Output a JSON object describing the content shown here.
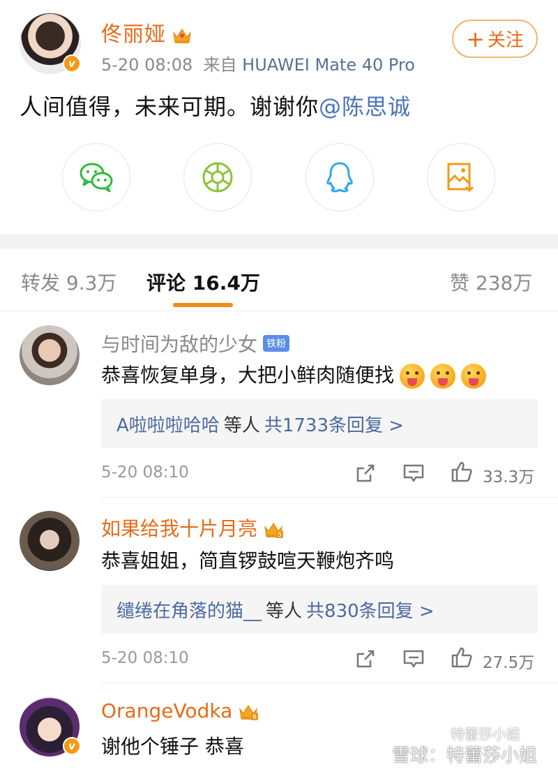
{
  "post": {
    "author": "佟丽娅",
    "time": "5-20 08:08",
    "source_prefix": "来自",
    "device": "HUAWEI Mate 40 Pro",
    "follow_label": "关注",
    "text": "人间值得，未来可期。谢谢你",
    "mention": "@陈思诚",
    "verified_badge": "v"
  },
  "share": [
    {
      "icon": "wechat-icon",
      "color": "#2dbb3c"
    },
    {
      "icon": "moments-icon",
      "color": "#8ac23a"
    },
    {
      "icon": "qq-icon",
      "color": "#2ea7e8"
    },
    {
      "icon": "save-image-icon",
      "color": "#f29a16"
    }
  ],
  "tabs": {
    "repost": "转发 9.3万",
    "comments": "评论 16.4万",
    "likes": "赞 238万"
  },
  "comments": [
    {
      "name": "与时间为敌的少女",
      "tag": "铁粉",
      "text": "恭喜恢复单身，大把小鲜肉随便找",
      "reply_who": "A啦啦啦哈哈",
      "reply_mid": "等人",
      "reply_count": "共1733条回复 >",
      "time": "5-20 08:10",
      "likes": "33.3万"
    },
    {
      "name": "如果给我十片月亮",
      "crown_level": "5",
      "text": "恭喜姐姐，简直锣鼓喧天鞭炮齐鸣",
      "reply_who": "缱绻在角落的猫__",
      "reply_mid": "等人",
      "reply_count": "共830条回复 >",
      "time": "5-20 08:10",
      "likes": "27.5万"
    },
    {
      "name": "OrangeVodka",
      "crown_level": "6",
      "text": "谢他个锤子 恭喜",
      "verified_badge": "v"
    }
  ],
  "watermark": {
    "line1": "特蕾莎小姐",
    "line2": "雪球：特蕾莎小姐"
  },
  "colors": {
    "accent": "#e86a15",
    "link": "#4a6aa0",
    "active_tab_underline": "#f08c1e"
  }
}
